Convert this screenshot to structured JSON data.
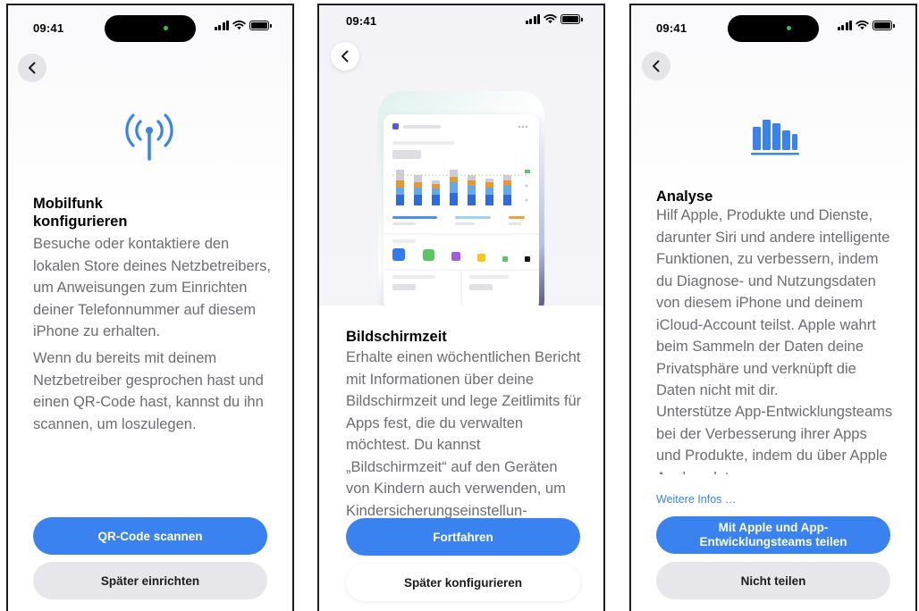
{
  "status": {
    "time": "09:41"
  },
  "screen1": {
    "title": "Mobilfunk konfigurieren",
    "body1": "Besuche oder kontaktiere den lokalen Store deines Netzbetreibers, um Anweisungen zum Einrichten deiner Telefonnummer auf diesem iPhone zu erhalten.",
    "body2": "Wenn du bereits mit deinem Netzbetreiber gesprochen hast und einen QR-Code hast, kannst du ihn scannen, um loszulegen.",
    "primary_button": "QR-Code scannen",
    "secondary_button": "Später einrichten",
    "icon": "antenna-radiowaves-icon",
    "accent": "#3b82f1"
  },
  "screen2": {
    "title": "Bildschirmzeit",
    "body": "Erhalte einen wöchentlichen Bericht mit Informationen über deine Bildschirmzeit und lege Zeitlimits für Apps fest, die du verwalten möchtest. Du kannst „Bildschirmzeit“ auf den Geräten von Kindern auch verwenden, um Kindersicherungseinstellun-",
    "primary_button": "Fortfahren",
    "secondary_button": "Später konfigurieren"
  },
  "screen3": {
    "title": "Analyse",
    "body1": "Hilf Apple, Produkte und Dienste, darunter Siri und andere intelligente Funktionen, zu verbessern, indem du Diagnose- und Nutzungsdaten von diesem iPhone und deinem iCloud-Account teilst. Apple wahrt beim Sammeln der Daten deine Privatsphäre und verknüpft die Daten nicht mit dir.",
    "body2": "Unterstütze App-Entwicklungsteams bei der Verbesserung ihrer Apps und Produkte, indem du über Apple Analysedaten",
    "link": "Weitere Infos …",
    "primary_button": "Mit Apple und App-Entwicklungsteams teilen",
    "secondary_button": "Nicht teilen",
    "icon": "chart-bar-icon"
  }
}
